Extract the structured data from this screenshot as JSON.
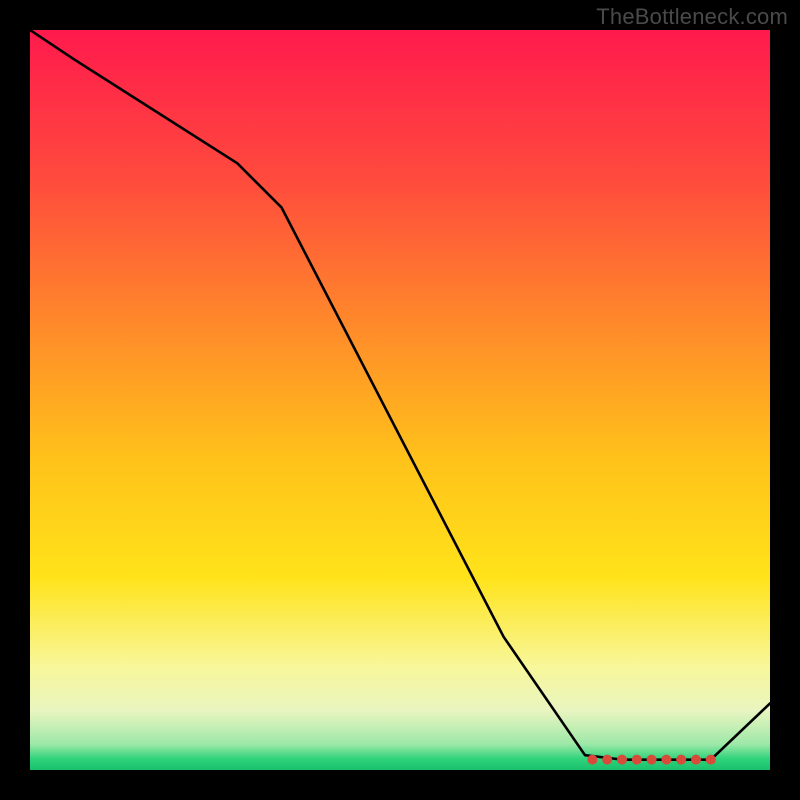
{
  "watermark": "TheBottleneck.com",
  "chart_data": {
    "type": "line",
    "title": "",
    "xlabel": "",
    "ylabel": "",
    "xlim": [
      0,
      100
    ],
    "ylim": [
      0,
      100
    ],
    "grid": false,
    "legend": false,
    "gradient_stops": [
      {
        "offset": 0.0,
        "color": "#ff1a4d"
      },
      {
        "offset": 0.2,
        "color": "#ff4a3d"
      },
      {
        "offset": 0.4,
        "color": "#ff8a2a"
      },
      {
        "offset": 0.58,
        "color": "#ffc21a"
      },
      {
        "offset": 0.74,
        "color": "#ffe31a"
      },
      {
        "offset": 0.86,
        "color": "#f8f79a"
      },
      {
        "offset": 0.92,
        "color": "#e9f5c0"
      },
      {
        "offset": 0.965,
        "color": "#9de8a8"
      },
      {
        "offset": 0.985,
        "color": "#2fd37a"
      },
      {
        "offset": 1.0,
        "color": "#1abf6e"
      }
    ],
    "series": [
      {
        "name": "curve",
        "color": "#000000",
        "x": [
          0,
          6,
          28,
          34,
          64,
          75,
          80,
          85,
          92,
          100
        ],
        "y": [
          100,
          96,
          82,
          76,
          18,
          2,
          1.4,
          1.4,
          1.4,
          9
        ]
      }
    ],
    "markers": {
      "name": "plateau-points",
      "color": "#d84a3a",
      "shape": "circle",
      "radius": 5,
      "x": [
        76,
        78,
        80,
        82,
        84,
        86,
        88,
        90,
        92
      ],
      "y": [
        1.4,
        1.4,
        1.4,
        1.4,
        1.4,
        1.4,
        1.4,
        1.4,
        1.4
      ]
    }
  }
}
